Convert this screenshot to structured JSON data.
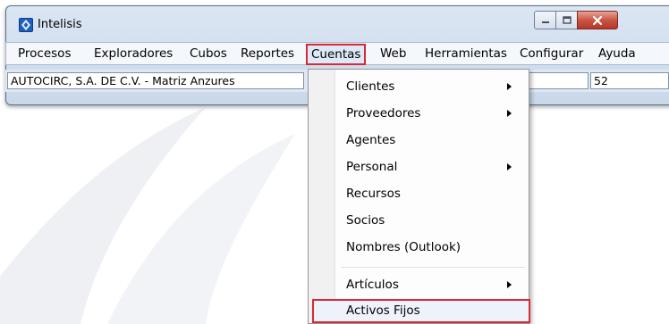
{
  "window": {
    "title": "Intelisis",
    "controls": {
      "minimize_icon": "minimize-icon",
      "maximize_icon": "maximize-icon",
      "close_icon": "close-icon"
    }
  },
  "menubar": {
    "items": [
      {
        "label": "Procesos"
      },
      {
        "label": "Exploradores"
      },
      {
        "label": "Cubos"
      },
      {
        "label": "Reportes"
      },
      {
        "label": "Cuentas"
      },
      {
        "label": "Web"
      },
      {
        "label": "Herramientas"
      },
      {
        "label": "Configurar"
      },
      {
        "label": "Ayuda"
      }
    ],
    "active_label": "Cuentas"
  },
  "status": {
    "company": "AUTOCIRC, S.A. DE C.V. - Matriz Anzures",
    "value": "52"
  },
  "dropdown": {
    "items": [
      {
        "label": "Clientes",
        "submenu": true
      },
      {
        "label": "Proveedores",
        "submenu": true
      },
      {
        "label": "Agentes",
        "submenu": false
      },
      {
        "label": "Personal",
        "submenu": true
      },
      {
        "label": "Recursos",
        "submenu": false
      },
      {
        "label": "Socios",
        "submenu": false
      },
      {
        "label": "Nombres (Outlook)",
        "submenu": false
      },
      {
        "label": "Artículos",
        "submenu": true
      },
      {
        "label": "Activos Fijos",
        "submenu": false
      }
    ]
  },
  "colors": {
    "highlight_border": "#d62a36"
  }
}
